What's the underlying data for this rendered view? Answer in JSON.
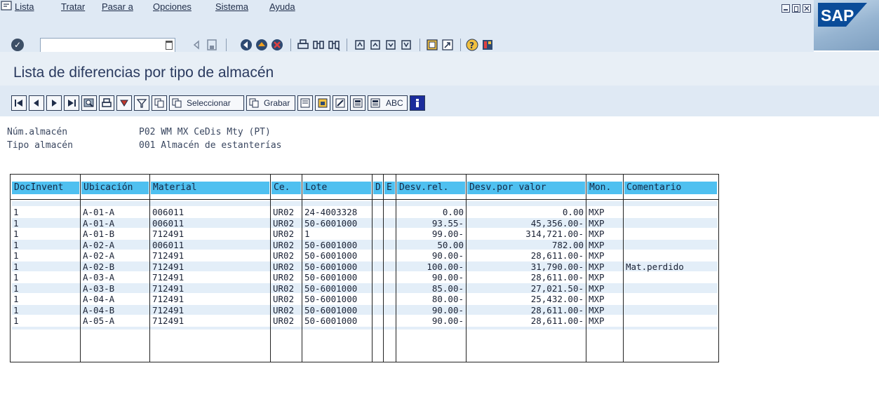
{
  "menu": {
    "items": [
      "Lista",
      "Tratar",
      "Pasar a",
      "Opciones",
      "Sistema",
      "Ayuda"
    ]
  },
  "logo_text": "SAP",
  "command_field": {
    "value": ""
  },
  "page_title": "Lista de diferencias por tipo de almacén",
  "app_toolbar": {
    "seleccionar_label": "Seleccionar",
    "grabar_label": "Grabar",
    "abc_label": "ABC"
  },
  "header": {
    "warehouse_label": "Núm.almacén",
    "warehouse_value": "P02 WM MX CeDis Mty (PT)",
    "storage_type_label": "Tipo almacén",
    "storage_type_value": "001 Almacén de estanterías"
  },
  "table": {
    "columns": [
      "DocInvent",
      "Ubicación",
      "Material",
      "Ce.",
      "Lote",
      "D",
      "E",
      "Desv.rel.",
      "Desv.por valor",
      "Mon.",
      "Comentario"
    ],
    "rows": [
      [
        "1",
        "A-01-A",
        "006011",
        "UR02",
        "24-4003328",
        "",
        "",
        "0.00",
        "0.00",
        "MXP",
        ""
      ],
      [
        "1",
        "A-01-A",
        "006011",
        "UR02",
        "50-6001000",
        "",
        "",
        "93.55-",
        "45,356.00-",
        "MXP",
        ""
      ],
      [
        "1",
        "A-01-B",
        "712491",
        "UR02",
        "1",
        "",
        "",
        "99.00-",
        "314,721.00-",
        "MXP",
        ""
      ],
      [
        "1",
        "A-02-A",
        "006011",
        "UR02",
        "50-6001000",
        "",
        "",
        "50.00",
        "782.00",
        "MXP",
        ""
      ],
      [
        "1",
        "A-02-A",
        "712491",
        "UR02",
        "50-6001000",
        "",
        "",
        "90.00-",
        "28,611.00-",
        "MXP",
        ""
      ],
      [
        "1",
        "A-02-B",
        "712491",
        "UR02",
        "50-6001000",
        "",
        "",
        "100.00-",
        "31,790.00-",
        "MXP",
        "Mat.perdido"
      ],
      [
        "1",
        "A-03-A",
        "712491",
        "UR02",
        "50-6001000",
        "",
        "",
        "90.00-",
        "28,611.00-",
        "MXP",
        ""
      ],
      [
        "1",
        "A-03-B",
        "712491",
        "UR02",
        "50-6001000",
        "",
        "",
        "85.00-",
        "27,021.50-",
        "MXP",
        ""
      ],
      [
        "1",
        "A-04-A",
        "712491",
        "UR02",
        "50-6001000",
        "",
        "",
        "80.00-",
        "25,432.00-",
        "MXP",
        ""
      ],
      [
        "1",
        "A-04-B",
        "712491",
        "UR02",
        "50-6001000",
        "",
        "",
        "90.00-",
        "28,611.00-",
        "MXP",
        ""
      ],
      [
        "1",
        "A-05-A",
        "712491",
        "UR02",
        "50-6001000",
        "",
        "",
        "90.00-",
        "28,611.00-",
        "MXP",
        ""
      ]
    ]
  },
  "colors": {
    "header_cell": "#4fc0f0",
    "row_band": "#e3eef8",
    "title_text": "#2a3a5f"
  }
}
